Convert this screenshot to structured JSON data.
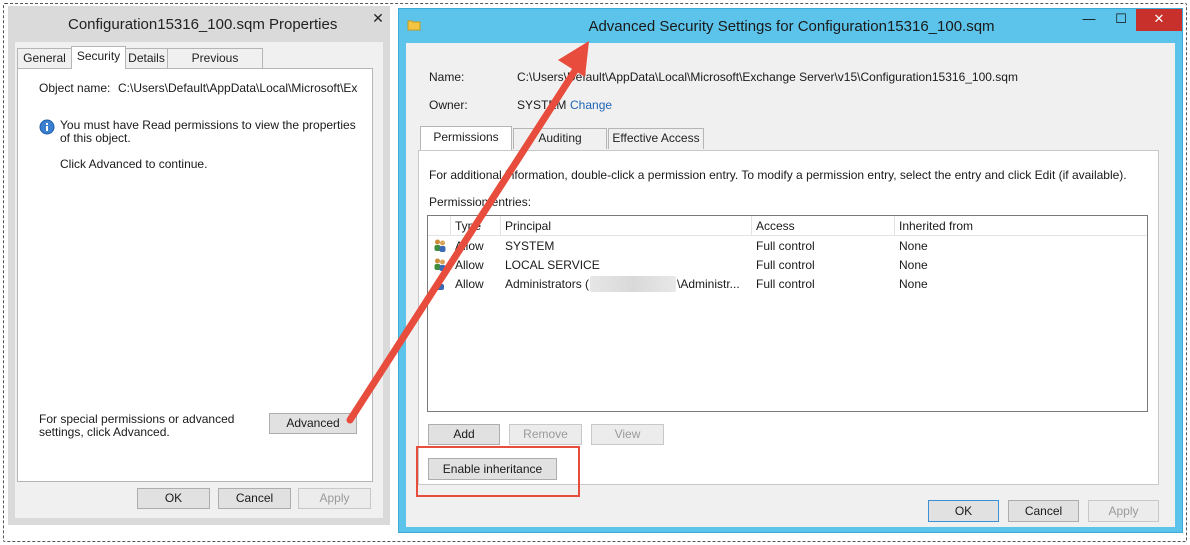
{
  "left_window": {
    "title": "Configuration15316_100.sqm Properties",
    "close_glyph": "✕",
    "tabs": [
      {
        "label": "General"
      },
      {
        "label": "Security"
      },
      {
        "label": "Details"
      },
      {
        "label": "Previous Versions"
      }
    ],
    "object_name_label": "Object name:",
    "object_name_value": "C:\\Users\\Default\\AppData\\Local\\Microsoft\\Excha",
    "info_message": "You must have Read permissions to view the properties of this object.",
    "continue_message": "Click Advanced to continue.",
    "special_text": "For special permissions or advanced settings, click Advanced.",
    "advanced_label": "Advanced",
    "ok_label": "OK",
    "cancel_label": "Cancel",
    "apply_label": "Apply"
  },
  "right_window": {
    "title": "Advanced Security Settings for Configuration15316_100.sqm",
    "minimize_glyph": "—",
    "maximize_glyph": "☐",
    "close_glyph": "✕",
    "name_label": "Name:",
    "name_value": "C:\\Users\\Default\\AppData\\Local\\Microsoft\\Exchange Server\\v15\\Configuration15316_100.sqm",
    "owner_label": "Owner:",
    "owner_value": "SYSTEM",
    "change_label": "Change",
    "tabs": [
      {
        "label": "Permissions"
      },
      {
        "label": "Auditing"
      },
      {
        "label": "Effective Access"
      }
    ],
    "info_text": "For additional information, double-click a permission entry. To modify a permission entry, select the entry and click Edit (if available).",
    "entries_label": "Permission entries:",
    "columns": [
      "Type",
      "Principal",
      "Access",
      "Inherited from"
    ],
    "rows": [
      {
        "type": "Allow",
        "principal": "SYSTEM",
        "access": "Full control",
        "inherited": "None"
      },
      {
        "type": "Allow",
        "principal": "LOCAL SERVICE",
        "access": "Full control",
        "inherited": "None"
      },
      {
        "type": "Allow",
        "principal_prefix": "Administrators (",
        "principal_suffix": "\\Administr...",
        "access": "Full control",
        "inherited": "None"
      }
    ],
    "add_label": "Add",
    "remove_label": "Remove",
    "view_label": "View",
    "enable_inheritance_label": "Enable inheritance",
    "ok_label": "OK",
    "cancel_label": "Cancel",
    "apply_label": "Apply"
  },
  "colors": {
    "titlebar_active": "#5cc3ea",
    "annotation_red": "#e74c3c",
    "link_blue": "#2066b8"
  }
}
